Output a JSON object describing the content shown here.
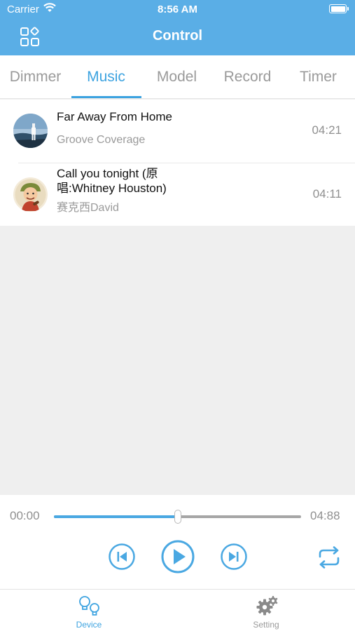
{
  "status_bar": {
    "carrier": "Carrier",
    "time": "8:56 AM"
  },
  "header": {
    "title": "Control",
    "left_icon": "apps-grid-icon"
  },
  "tabs": [
    {
      "label": "Dimmer",
      "active": false
    },
    {
      "label": "Music",
      "active": true
    },
    {
      "label": "Model",
      "active": false
    },
    {
      "label": "Record",
      "active": false
    },
    {
      "label": "Timer",
      "active": false
    }
  ],
  "songs": [
    {
      "title": "Far Away From Home",
      "artist": "Groove Coverage",
      "duration": "04:21",
      "cover_icon": "album-cover-stage"
    },
    {
      "title_line1": "Call you tonight (原",
      "title_line2": "唱:Whitney Houston)",
      "artist": "赛克西David",
      "duration": "04:11",
      "cover_icon": "album-cover-cartoon"
    }
  ],
  "player": {
    "elapsed": "00:00",
    "total": "04:88",
    "progress": 0.5,
    "controls": [
      "previous-icon",
      "play-icon",
      "next-icon",
      "repeat-icon"
    ]
  },
  "colors": {
    "accent": "#3da3e0",
    "header": "#5aaee6",
    "background": "#efefef"
  },
  "bottom_nav": [
    {
      "label": "Device",
      "icon": "device-bulbs-icon",
      "active": true
    },
    {
      "label": "Setting",
      "icon": "gears-icon",
      "active": false
    }
  ]
}
